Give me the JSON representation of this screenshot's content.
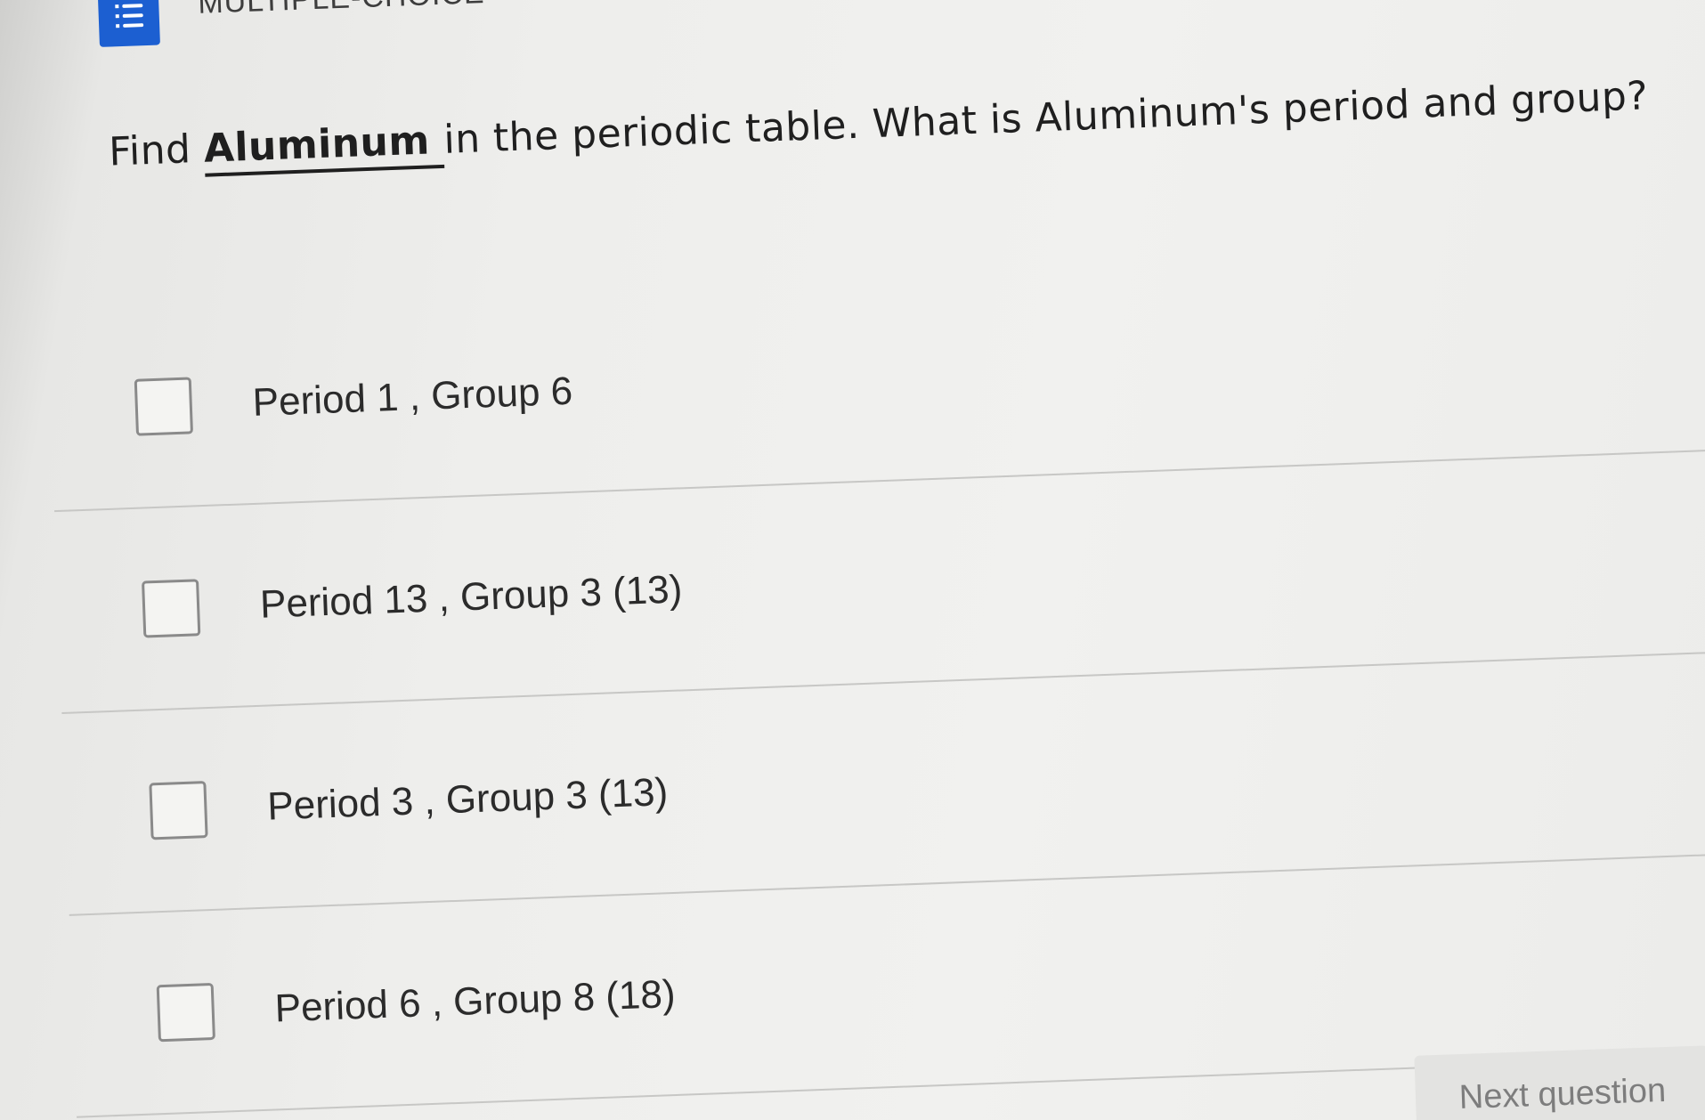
{
  "header": {
    "type_icon": "numbered-list-icon",
    "type_label": "MULTIPLE-CHOICE"
  },
  "question": {
    "prefix": "Find ",
    "keyword": "Aluminum ",
    "suffix": "in the periodic table. What is Aluminum's period and group?"
  },
  "options": [
    {
      "label": "Period 1 , Group 6"
    },
    {
      "label": "Period 13 , Group 3 (13)"
    },
    {
      "label": "Period 3 , Group 3 (13)"
    },
    {
      "label": "Period 6 , Group 8 (18)"
    }
  ],
  "footer": {
    "next_label": "Next question"
  },
  "colors": {
    "accent": "#1c5fd1",
    "background": "#eeeeec",
    "text": "#1f1f1f"
  }
}
